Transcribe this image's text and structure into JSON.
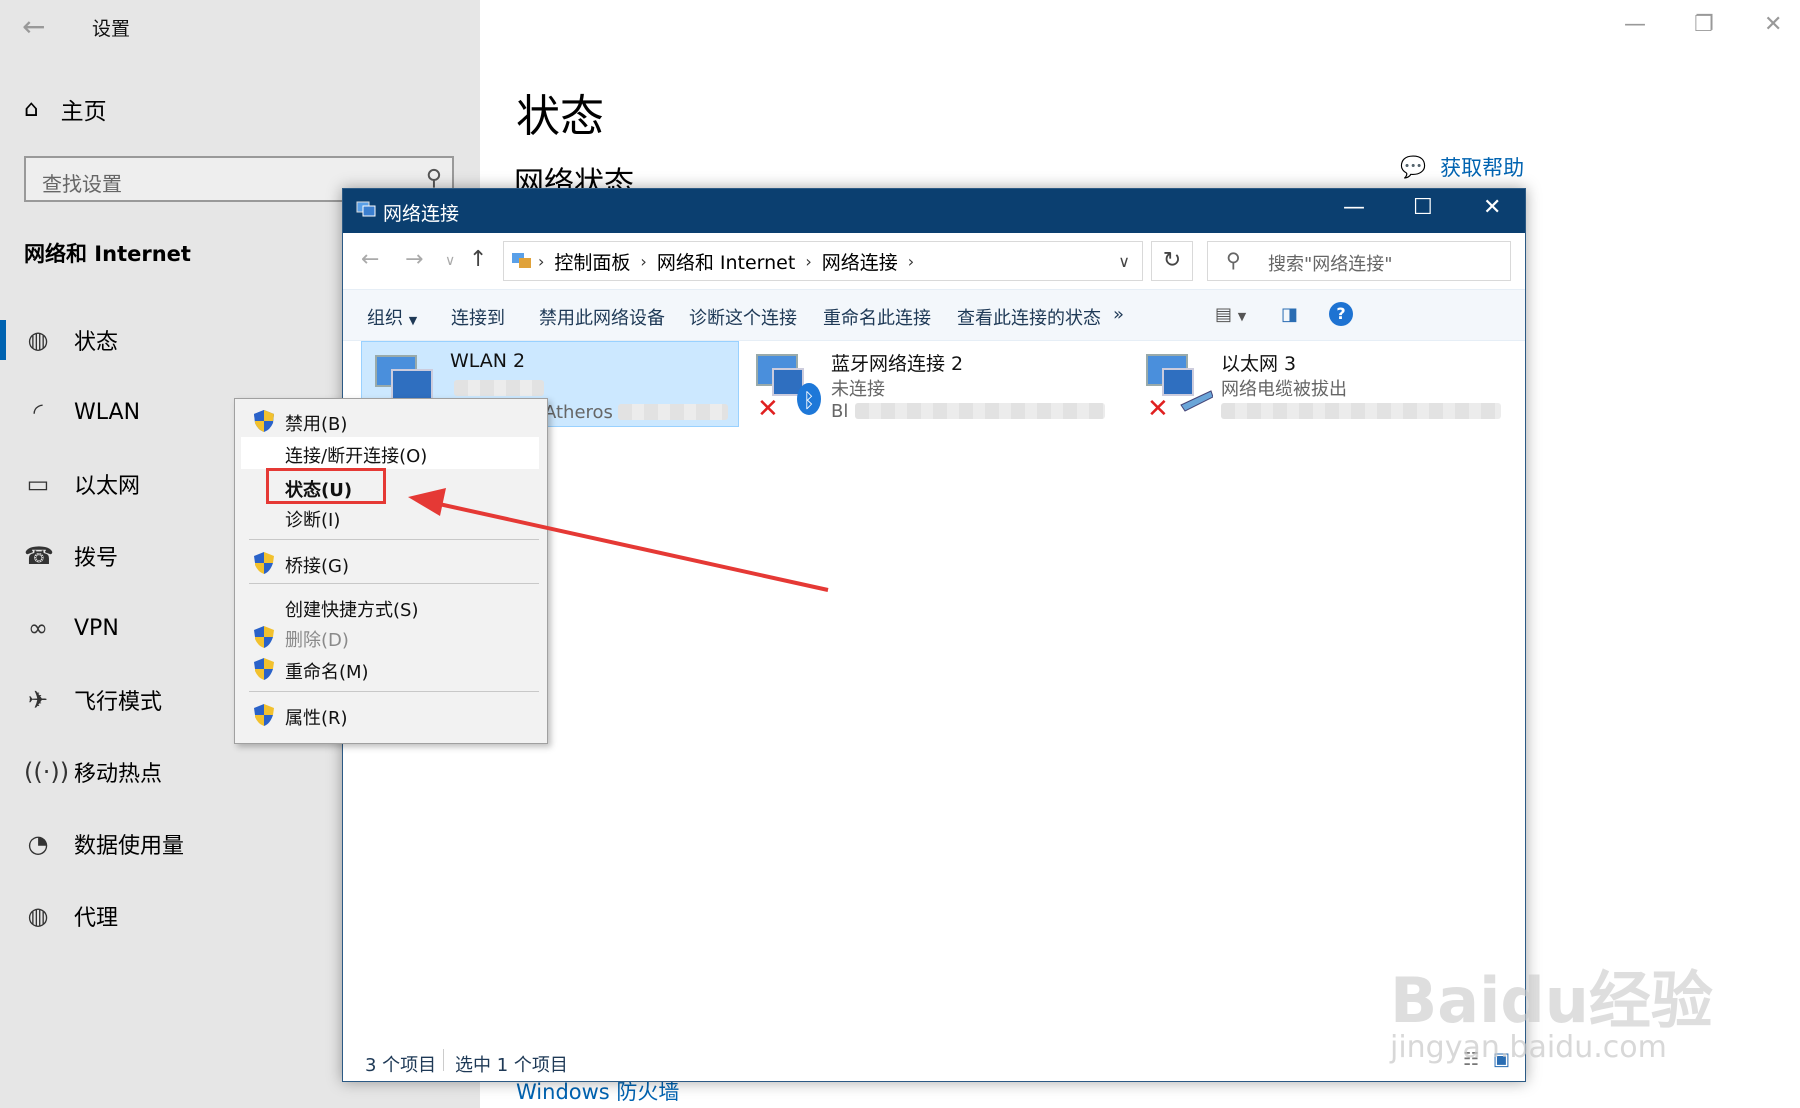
{
  "settings": {
    "window_title": "设置",
    "home_label": "主页",
    "search_placeholder": "查找设置",
    "section_title": "网络和 Internet",
    "nav": [
      {
        "label": "状态",
        "icon": "globe-icon",
        "active": true
      },
      {
        "label": "WLAN",
        "icon": "wifi-icon"
      },
      {
        "label": "以太网",
        "icon": "ethernet-icon"
      },
      {
        "label": "拨号",
        "icon": "dialup-icon"
      },
      {
        "label": "VPN",
        "icon": "vpn-icon"
      },
      {
        "label": "飞行模式",
        "icon": "airplane-icon"
      },
      {
        "label": "移动热点",
        "icon": "hotspot-icon"
      },
      {
        "label": "数据使用量",
        "icon": "pie-icon"
      },
      {
        "label": "代理",
        "icon": "globe-icon"
      }
    ],
    "main_title": "状态",
    "subtitle": "网络状态",
    "help_label": "获取帮助",
    "firewall_link": "Windows 防火墙"
  },
  "explorer": {
    "title": "网络连接",
    "breadcrumb": [
      "控制面板",
      "网络和 Internet",
      "网络连接"
    ],
    "search_placeholder": "搜索\"网络连接\"",
    "commands": [
      "组织",
      "连接到",
      "禁用此网络设备",
      "诊断这个连接",
      "重命名此连接",
      "查看此连接的状态",
      "»"
    ],
    "items": [
      {
        "name": "WLAN 2",
        "status": "",
        "device": "Atheros",
        "selected": true
      },
      {
        "name": "蓝牙网络连接 2",
        "status": "未连接",
        "device": "Bl",
        "selected": false
      },
      {
        "name": "以太网 3",
        "status": "网络电缆被拔出",
        "device": "",
        "selected": false
      }
    ],
    "status_count": "3 个项目",
    "status_selected": "选中 1 个项目"
  },
  "context_menu": [
    {
      "label": "禁用(B)",
      "shield": true
    },
    {
      "label": "连接/断开连接(O)",
      "shield": false
    },
    {
      "label": "状态(U)",
      "shield": false,
      "bold": true
    },
    {
      "label": "诊断(I)",
      "shield": false
    },
    {
      "label": "桥接(G)",
      "shield": true
    },
    {
      "label": "创建快捷方式(S)",
      "shield": false
    },
    {
      "label": "删除(D)",
      "shield": true,
      "disabled": true
    },
    {
      "label": "重命名(M)",
      "shield": true
    },
    {
      "label": "属性(R)",
      "shield": true
    }
  ],
  "colors": {
    "accent": "#0063b1",
    "titlebar": "#0b3f70",
    "selection": "#cce8ff",
    "annotation": "#e53935"
  },
  "watermark": {
    "line1": "Baidu经验",
    "line2": "jingyan.baidu.com"
  }
}
